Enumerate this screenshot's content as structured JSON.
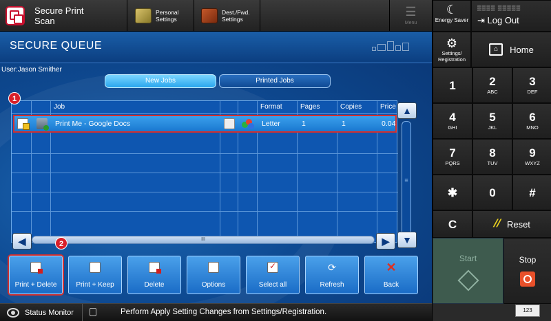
{
  "header": {
    "app_name_line1": "Secure Print",
    "app_name_line2": "Scan",
    "shortcut1_line1": "Personal",
    "shortcut1_line2": "Settings",
    "shortcut2_line1": "Dest./Fwd.",
    "shortcut2_line2": "Settings",
    "menu_label": "Menu"
  },
  "screen": {
    "title": "SECURE QUEUE",
    "user_line": "User:Jason Smither",
    "tabs": [
      {
        "label": "New Jobs",
        "selected": true
      },
      {
        "label": "Printed Jobs",
        "selected": false
      }
    ]
  },
  "table": {
    "columns": [
      "",
      "",
      "Job",
      "",
      "",
      "Format",
      "Pages",
      "Copies",
      "Price"
    ],
    "rows": [
      {
        "job": "Print Me - Google Docs",
        "format": "Letter",
        "pages": "1",
        "copies": "1",
        "price": "0.04"
      }
    ],
    "hscroll_grip": "III",
    "vscroll_grip": "≡"
  },
  "badges": {
    "one": "1",
    "two": "2"
  },
  "actions": [
    {
      "label": "Print + Delete",
      "icon": "print-delete-icon",
      "selected": true
    },
    {
      "label": "Print + Keep",
      "icon": "print-keep-icon",
      "selected": false
    },
    {
      "label": "Delete",
      "icon": "delete-icon",
      "selected": false
    },
    {
      "label": "Options",
      "icon": "options-icon",
      "selected": false
    },
    {
      "label": "Select all",
      "icon": "select-all-icon",
      "selected": false
    },
    {
      "label": "Refresh",
      "icon": "refresh-icon",
      "selected": false
    },
    {
      "label": "Back",
      "icon": "back-icon",
      "selected": false
    }
  ],
  "status": {
    "monitor_label": "Status Monitor",
    "message": "Perform Apply Setting Changes from Settings/Registration.",
    "keyboard_label": "123"
  },
  "panel": {
    "energy_label": "Energy Saver",
    "logout_label": "Log Out",
    "settings_line1": "Settings/",
    "settings_line2": "Registration",
    "home_label": "Home",
    "keys": [
      {
        "digit": "1",
        "sub": ""
      },
      {
        "digit": "2",
        "sub": "ABC"
      },
      {
        "digit": "3",
        "sub": "DEF"
      },
      {
        "digit": "4",
        "sub": "GHI"
      },
      {
        "digit": "5",
        "sub": "JKL"
      },
      {
        "digit": "6",
        "sub": "MNO"
      },
      {
        "digit": "7",
        "sub": "PQRS"
      },
      {
        "digit": "8",
        "sub": "TUV"
      },
      {
        "digit": "9",
        "sub": "WXYZ"
      },
      {
        "digit": "✱",
        "sub": ""
      },
      {
        "digit": "0",
        "sub": ""
      },
      {
        "digit": "#",
        "sub": ""
      }
    ],
    "clear_label": "C",
    "reset_label": "Reset",
    "start_label": "Start",
    "stop_label": "Stop"
  },
  "colors": {
    "accent": "#1a6cc6",
    "highlight_red": "#d03030",
    "start_green": "#3e5b4e",
    "stop_orange": "#e8502a"
  }
}
